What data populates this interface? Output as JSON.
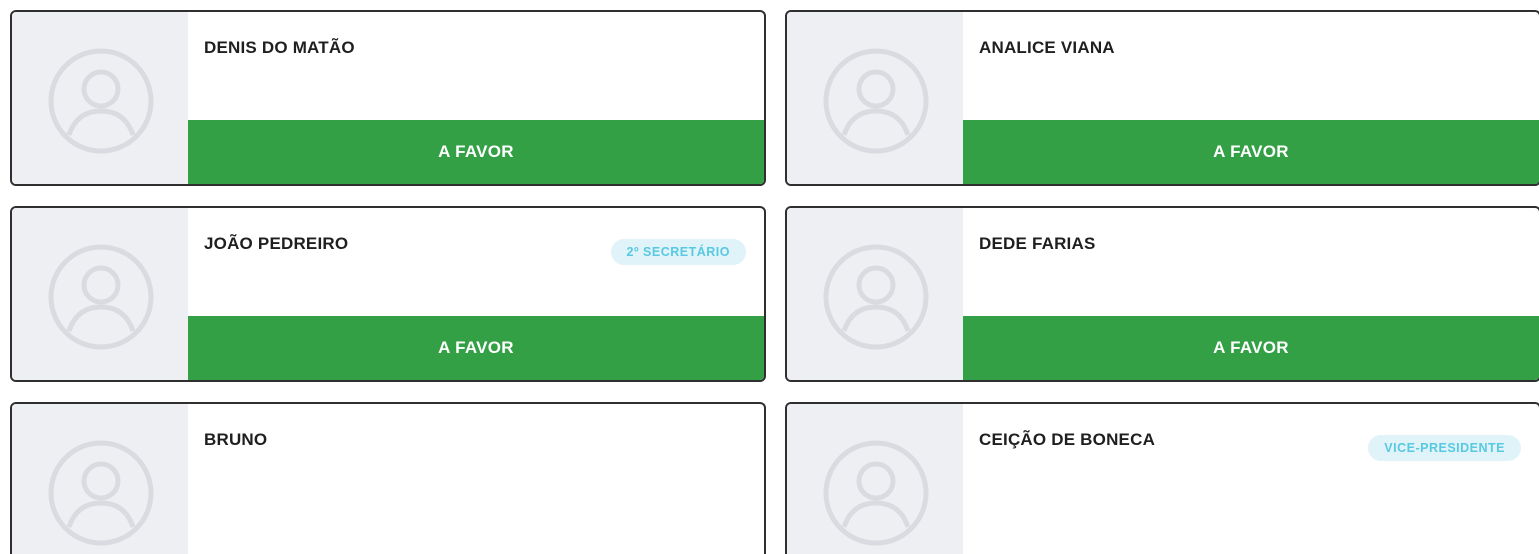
{
  "colors": {
    "vote_favor": "#34a046",
    "avatar_bg": "#eeeff2",
    "badge_bg": "#dff3f8",
    "badge_text": "#58c9e2",
    "card_border": "#2f2f2f"
  },
  "members": [
    {
      "name": "DENIS DO MATÃO",
      "role": "",
      "vote": "A FAVOR",
      "avatar_icon": "user-avatar-icon"
    },
    {
      "name": "ANALICE VIANA",
      "role": "",
      "vote": "A FAVOR",
      "avatar_icon": "user-avatar-icon"
    },
    {
      "name": "JOÃO PEDREIRO",
      "role": "2º SECRETÁRIO",
      "vote": "A FAVOR",
      "avatar_icon": "user-avatar-icon"
    },
    {
      "name": "DEDE FARIAS",
      "role": "",
      "vote": "A FAVOR",
      "avatar_icon": "user-avatar-icon"
    },
    {
      "name": "BRUNO",
      "role": "",
      "vote": "",
      "avatar_icon": "user-avatar-icon"
    },
    {
      "name": "CEIÇÃO DE BONECA",
      "role": "VICE-PRESIDENTE",
      "vote": "",
      "avatar_icon": "user-avatar-icon"
    }
  ]
}
